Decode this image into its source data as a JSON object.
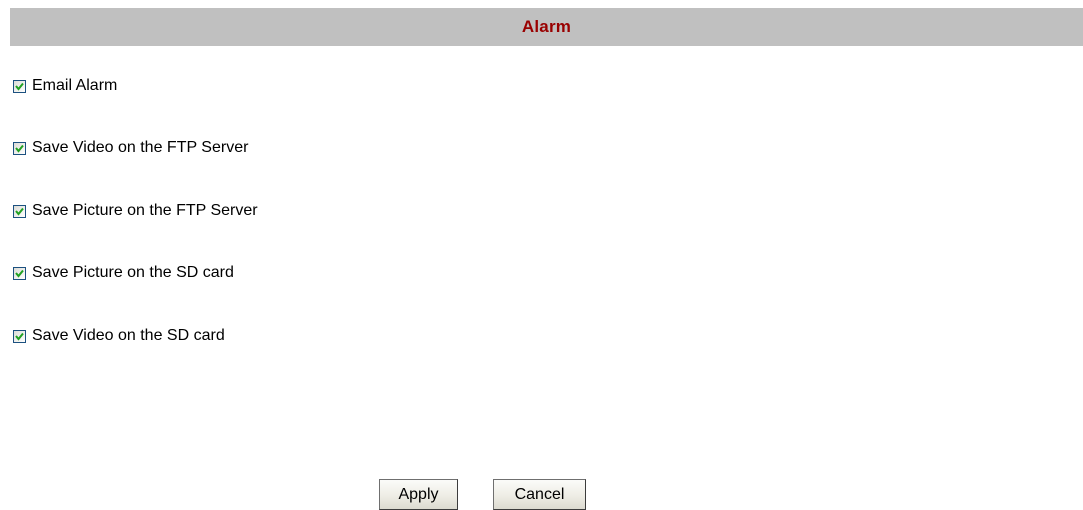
{
  "header": {
    "title": "Alarm"
  },
  "options": [
    {
      "label": "Email Alarm",
      "checked": true
    },
    {
      "label": "Save Video on the FTP Server",
      "checked": true
    },
    {
      "label": "Save Picture on the FTP Server",
      "checked": true
    },
    {
      "label": "Save Picture on the SD card",
      "checked": true
    },
    {
      "label": "Save Video on the SD card",
      "checked": true
    }
  ],
  "buttons": {
    "apply": "Apply",
    "cancel": "Cancel"
  },
  "colors": {
    "header_bg": "#c0c0c0",
    "header_text": "#990000",
    "checkmark": "#21a121",
    "checkbox_border": "#1c5180"
  }
}
